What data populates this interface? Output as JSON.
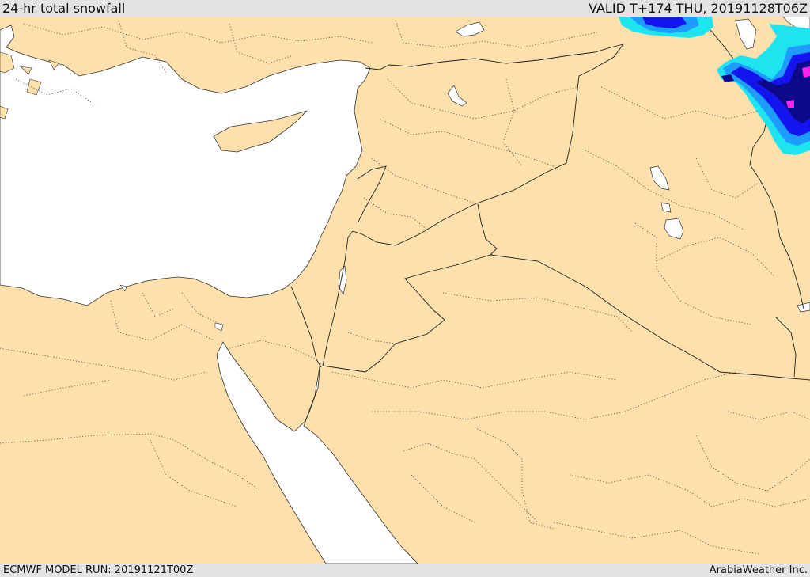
{
  "header": {
    "title": "24-hr total snowfall",
    "valid": "VALID T+174 THU, 20191128T06Z"
  },
  "footer": {
    "model_run": "ECMWF MODEL RUN: 20191121T00Z",
    "credit": "ArabiaWeather Inc."
  },
  "colors": {
    "land": "#fde0ac",
    "water": "#ffffff",
    "border": "#333333",
    "snow_light": "#1de4ee",
    "snow_mid": "#1e9bff",
    "snow_heavy": "#1414ee",
    "snow_deep": "#0d0a8a",
    "snow_extreme": "#ff22ee"
  }
}
